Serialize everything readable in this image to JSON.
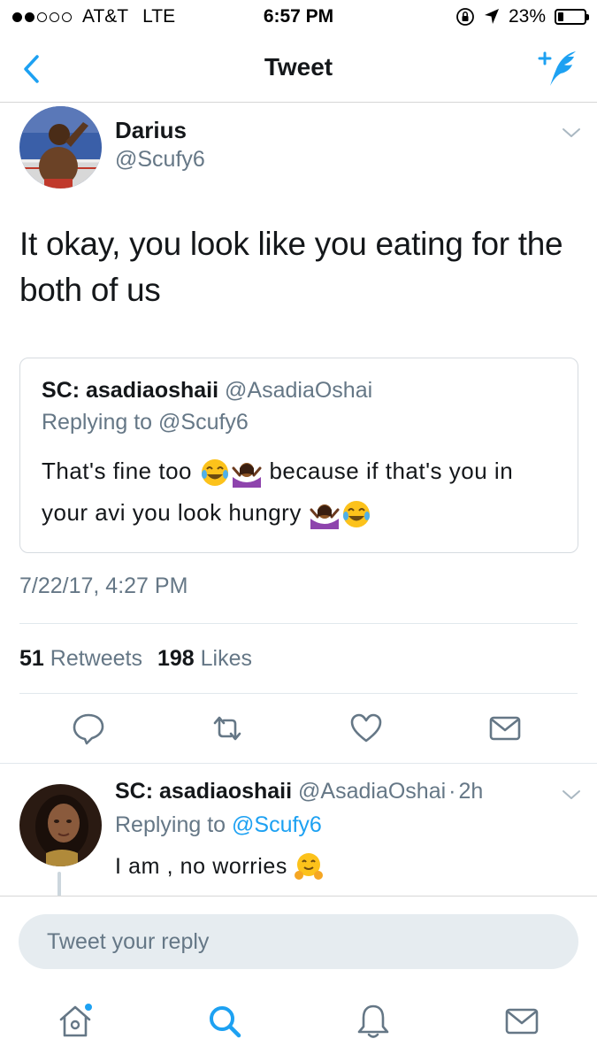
{
  "status_bar": {
    "carrier": "AT&T",
    "network": "LTE",
    "time": "6:57 PM",
    "battery": "23%",
    "battery_level": 0.23
  },
  "nav": {
    "title": "Tweet",
    "back_icon": "chevron-left-icon",
    "compose_icon": "compose-tweet-icon"
  },
  "tweet": {
    "author_name": "Darius",
    "author_handle": "@Scufy6",
    "text": "It okay, you look like you eating for the both of us",
    "timestamp": "7/22/17, 4:27 PM",
    "retweets_count": "51",
    "retweets_label": "Retweets",
    "likes_count": "198",
    "likes_label": "Likes"
  },
  "quoted": {
    "name": "SC: asadiaoshaii",
    "handle": "@AsadiaOshai",
    "replying": "Replying to @Scufy6",
    "text_part1": "That's fine too",
    "text_part2": "because if that's you in your avi you look hungry"
  },
  "actions": [
    {
      "name": "reply-icon"
    },
    {
      "name": "retweet-icon"
    },
    {
      "name": "like-icon"
    },
    {
      "name": "dm-icon"
    }
  ],
  "reply": {
    "name": "SC: asadiaoshaii",
    "handle": "@AsadiaOshai",
    "separator": "·",
    "time": "2h",
    "replying_prefix": "Replying to",
    "replying_handle": "@Scufy6",
    "text": "I am , no worries"
  },
  "composer": {
    "placeholder": "Tweet your reply"
  },
  "tabs": [
    {
      "name": "home-icon"
    },
    {
      "name": "search-icon"
    },
    {
      "name": "notifications-icon"
    },
    {
      "name": "messages-icon"
    }
  ],
  "colors": {
    "accent": "#1da1f2",
    "secondary_text": "#657786",
    "primary_text": "#14171a"
  }
}
